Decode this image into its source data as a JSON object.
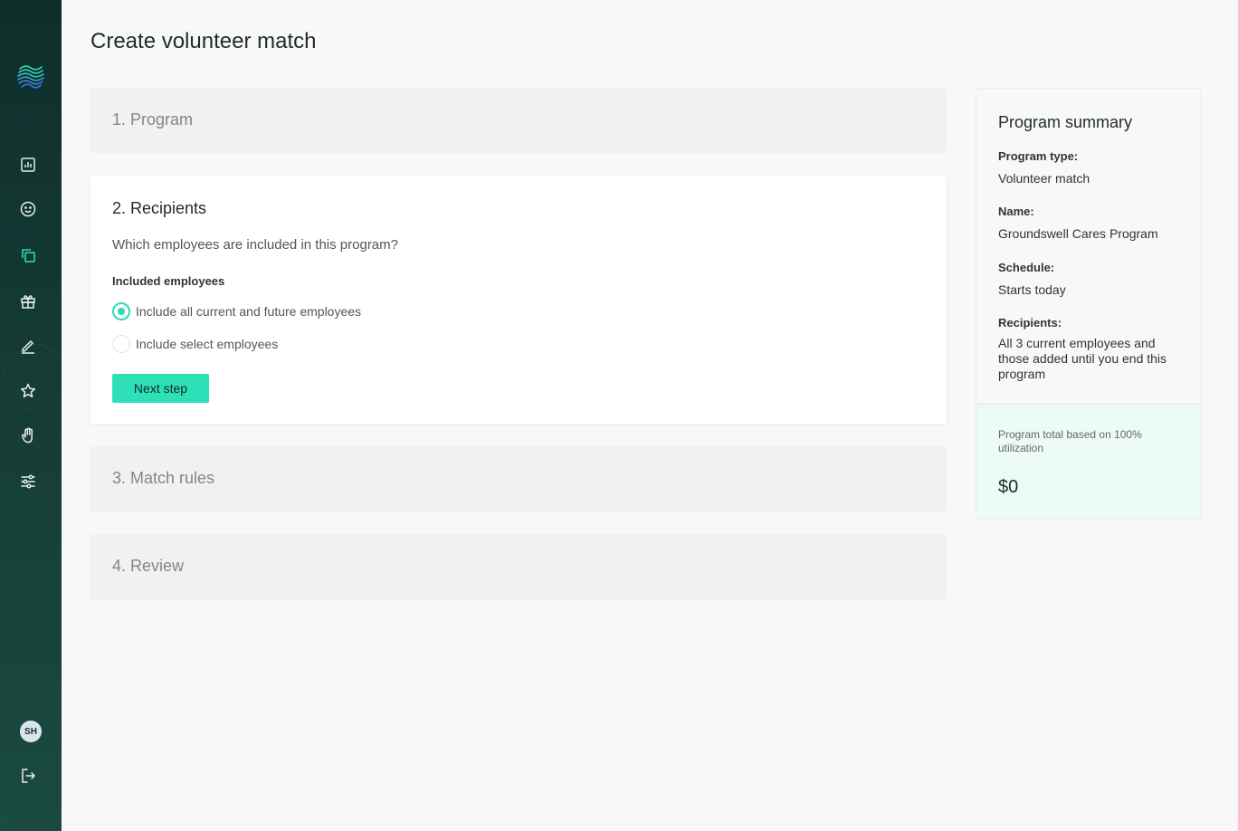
{
  "page": {
    "title": "Create volunteer match"
  },
  "sidebar": {
    "logo": "waves-logo",
    "items": [
      {
        "icon": "bar-chart-icon"
      },
      {
        "icon": "smiley-icon"
      },
      {
        "icon": "copy-icon",
        "active": true
      },
      {
        "icon": "gift-icon"
      },
      {
        "icon": "pen-icon"
      },
      {
        "icon": "star-icon"
      },
      {
        "icon": "hand-icon"
      },
      {
        "icon": "sliders-icon"
      }
    ],
    "avatar_initials": "SH",
    "logout_icon": "logout-icon"
  },
  "steps": {
    "program": {
      "title": "1. Program"
    },
    "recipients": {
      "title": "2. Recipients",
      "question": "Which employees are included in this program?",
      "field_label": "Included employees",
      "options": [
        {
          "label": "Include all current and future employees",
          "selected": true
        },
        {
          "label": "Include select employees",
          "selected": false
        }
      ],
      "next_label": "Next step"
    },
    "match_rules": {
      "title": "3. Match rules"
    },
    "review": {
      "title": "4. Review"
    }
  },
  "summary": {
    "title": "Program summary",
    "fields": [
      {
        "label": "Program type:",
        "value": "Volunteer match"
      },
      {
        "label": "Name:",
        "value": "Groundswell Cares Program"
      },
      {
        "label": "Schedule:",
        "value": "Starts today"
      },
      {
        "label": "Recipients:",
        "value": "All 3 current employees and those added until you end this program"
      }
    ],
    "footer_note": "Program total based on 100% utilization",
    "total": "$0"
  },
  "colors": {
    "accent": "#2ee0b8",
    "sidebar_bg": "#143a34",
    "summary_footer_bg": "#ecfbf6"
  }
}
